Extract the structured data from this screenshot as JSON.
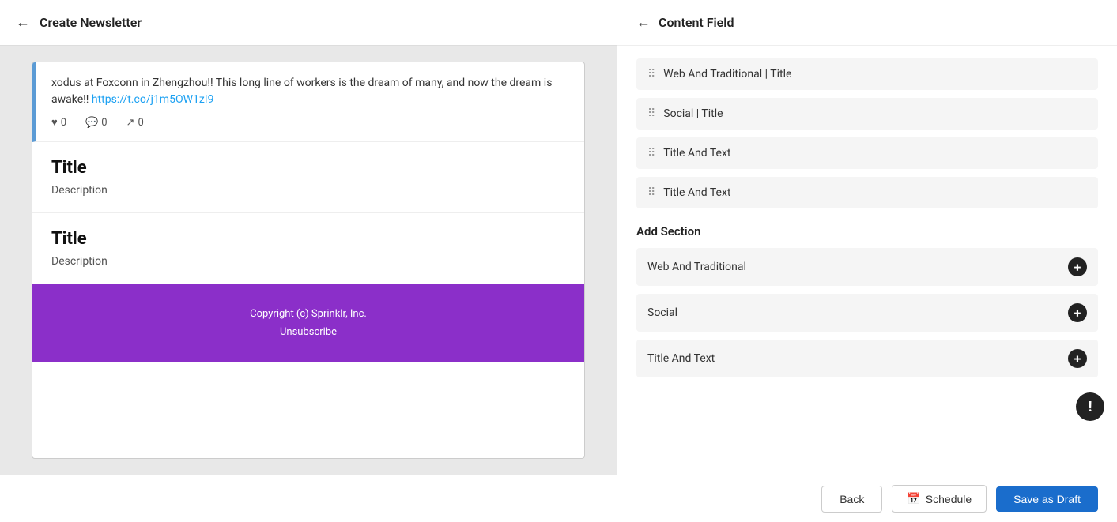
{
  "header": {
    "title": "Create Newsletter",
    "back_icon": "←"
  },
  "left": {
    "tweet": {
      "text": "xodus at Foxconn in Zhengzhou!! This long line of workers is the dream of many, and now the dream is awake!!",
      "link_text": "https://t.co/j1m5OW1zI9",
      "link_url": "#",
      "likes": "0",
      "comments": "0",
      "shares": "0"
    },
    "sections": [
      {
        "title": "Title",
        "description": "Description"
      },
      {
        "title": "Title",
        "description": "Description"
      }
    ],
    "footer": {
      "copyright": "Copyright (c) Sprinklr, Inc.",
      "unsubscribe": "Unsubscribe"
    }
  },
  "right": {
    "header_back": "←",
    "title": "Content Field",
    "fields": [
      {
        "label": "Web And Traditional | Title"
      },
      {
        "label": "Social | Title"
      },
      {
        "label": "Title And Text"
      },
      {
        "label": "Title And Text"
      }
    ],
    "add_section_title": "Add Section",
    "sections": [
      {
        "label": "Web And Traditional"
      },
      {
        "label": "Social"
      },
      {
        "label": "Title And Text"
      }
    ]
  },
  "bottom_bar": {
    "back_label": "Back",
    "schedule_label": "Schedule",
    "save_draft_label": "Save as Draft",
    "calendar_icon": "📅"
  },
  "colors": {
    "footer_bg": "#8b2fc9",
    "save_btn_bg": "#1a6dcc",
    "add_btn_bg": "#222222"
  }
}
